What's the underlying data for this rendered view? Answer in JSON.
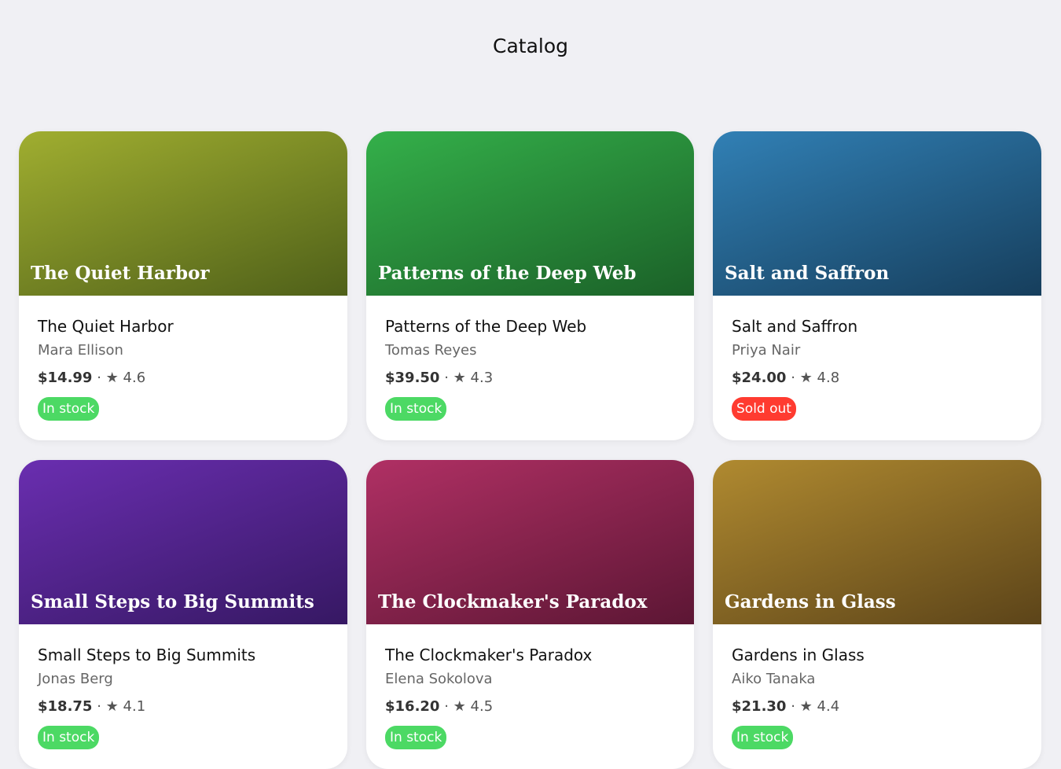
{
  "header": {
    "title": "Catalog"
  },
  "books": [
    {
      "title": "The Quiet Harbor",
      "author": "Mara Ellison",
      "price": "$14.99",
      "separator": "·",
      "star": "★",
      "rating": "4.6",
      "status": "In stock",
      "status_color": "#4cd964",
      "gradient_from": "#a0ae30",
      "gradient_to": "#4f6019"
    },
    {
      "title": "Patterns of the Deep Web",
      "author": "Tomas Reyes",
      "price": "$39.50",
      "separator": "·",
      "star": "★",
      "rating": "4.3",
      "status": "In stock",
      "status_color": "#4cd964",
      "gradient_from": "#34b04a",
      "gradient_to": "#1b6128"
    },
    {
      "title": "Salt and Saffron",
      "author": "Priya Nair",
      "price": "$24.00",
      "separator": "·",
      "star": "★",
      "rating": "4.8",
      "status": "Sold out",
      "status_color": "#ff3b30",
      "gradient_from": "#3180b5",
      "gradient_to": "#163e5c"
    },
    {
      "title": "Small Steps to Big Summits",
      "author": "Jonas Berg",
      "price": "$18.75",
      "separator": "·",
      "star": "★",
      "rating": "4.1",
      "status": "In stock",
      "status_color": "#4cd964",
      "gradient_from": "#6a2eb0",
      "gradient_to": "#361863"
    },
    {
      "title": "The Clockmaker's Paradox",
      "author": "Elena Sokolova",
      "price": "$16.20",
      "separator": "·",
      "star": "★",
      "rating": "4.5",
      "status": "In stock",
      "status_color": "#4cd964",
      "gradient_from": "#b03064",
      "gradient_to": "#5c1634"
    },
    {
      "title": "Gardens in Glass",
      "author": "Aiko Tanaka",
      "price": "$21.30",
      "separator": "·",
      "star": "★",
      "rating": "4.4",
      "status": "In stock",
      "status_color": "#4cd964",
      "gradient_from": "#b08a30",
      "gradient_to": "#5c4419"
    }
  ]
}
